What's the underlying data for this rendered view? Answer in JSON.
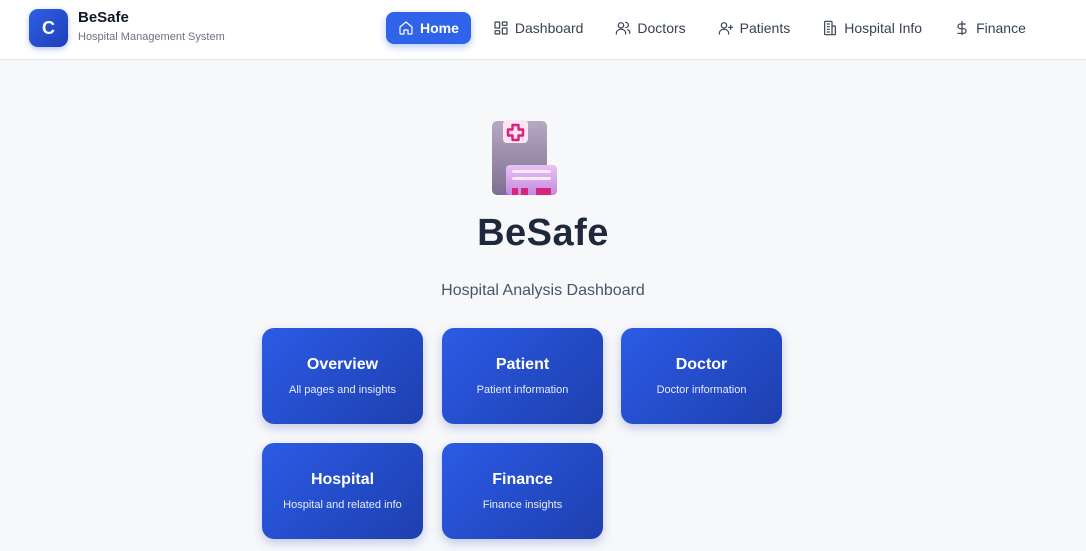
{
  "brand": {
    "logo_letter": "C",
    "name": "BeSafe",
    "subtitle": "Hospital Management System"
  },
  "nav": {
    "items": [
      {
        "label": "Home",
        "icon": "home-icon",
        "active": true
      },
      {
        "label": "Dashboard",
        "icon": "grid-icon"
      },
      {
        "label": "Doctors",
        "icon": "users-icon"
      },
      {
        "label": "Patients",
        "icon": "user-plus-icon"
      },
      {
        "label": "Hospital Info",
        "icon": "building-icon"
      },
      {
        "label": "Finance",
        "icon": "dollar-icon"
      }
    ]
  },
  "hero": {
    "icon": "hospital-building-icon",
    "title": "BeSafe",
    "subtitle": "Hospital Analysis Dashboard"
  },
  "cards": [
    {
      "title": "Overview",
      "desc": "All pages and insights"
    },
    {
      "title": "Patient",
      "desc": "Patient information"
    },
    {
      "title": "Doctor",
      "desc": "Doctor information"
    },
    {
      "title": "Hospital",
      "desc": "Hospital and related info"
    },
    {
      "title": "Finance",
      "desc": "Finance insights"
    }
  ],
  "colors": {
    "accent": "#2f63ea",
    "card_start": "#2b5be6",
    "card_end": "#1e3fae",
    "background": "#f7f8fa"
  }
}
